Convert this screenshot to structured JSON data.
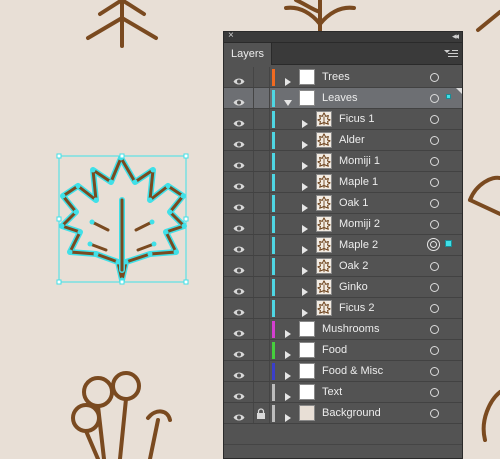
{
  "panel": {
    "tab_label": "Layers",
    "close_glyph": "×",
    "collapse_glyph": "◂◂"
  },
  "layers": [
    {
      "label": "Trees",
      "level": 0,
      "expanded": false,
      "color": "#f06a21",
      "thumb": "white",
      "selected": false,
      "active_target": false,
      "sel_square": false,
      "lock": false
    },
    {
      "label": "Leaves",
      "level": 0,
      "expanded": true,
      "color": "#4fd6e3",
      "thumb": "white",
      "selected": true,
      "active_target": false,
      "sel_square": true,
      "lock": false
    },
    {
      "label": "Ficus 1",
      "level": 1,
      "expanded": false,
      "color": "#4fd6e3",
      "thumb": "leaf",
      "selected": false,
      "active_target": false,
      "sel_square": false,
      "lock": false
    },
    {
      "label": "Alder",
      "level": 1,
      "expanded": false,
      "color": "#4fd6e3",
      "thumb": "leaf",
      "selected": false,
      "active_target": false,
      "sel_square": false,
      "lock": false
    },
    {
      "label": "Momiji 1",
      "level": 1,
      "expanded": false,
      "color": "#4fd6e3",
      "thumb": "leaf",
      "selected": false,
      "active_target": false,
      "sel_square": false,
      "lock": false
    },
    {
      "label": "Maple 1",
      "level": 1,
      "expanded": false,
      "color": "#4fd6e3",
      "thumb": "leaf",
      "selected": false,
      "active_target": false,
      "sel_square": false,
      "lock": false
    },
    {
      "label": "Oak 1",
      "level": 1,
      "expanded": false,
      "color": "#4fd6e3",
      "thumb": "leaf",
      "selected": false,
      "active_target": false,
      "sel_square": false,
      "lock": false
    },
    {
      "label": "Momiji 2",
      "level": 1,
      "expanded": false,
      "color": "#4fd6e3",
      "thumb": "leaf",
      "selected": false,
      "active_target": false,
      "sel_square": false,
      "lock": false
    },
    {
      "label": "Maple 2",
      "level": 1,
      "expanded": false,
      "color": "#4fd6e3",
      "thumb": "leaf",
      "selected": false,
      "active_target": true,
      "sel_square": true,
      "lock": false
    },
    {
      "label": "Oak 2",
      "level": 1,
      "expanded": false,
      "color": "#4fd6e3",
      "thumb": "leaf",
      "selected": false,
      "active_target": false,
      "sel_square": false,
      "lock": false
    },
    {
      "label": "Ginko",
      "level": 1,
      "expanded": false,
      "color": "#4fd6e3",
      "thumb": "leaf",
      "selected": false,
      "active_target": false,
      "sel_square": false,
      "lock": false
    },
    {
      "label": "Ficus 2",
      "level": 1,
      "expanded": false,
      "color": "#4fd6e3",
      "thumb": "leaf",
      "selected": false,
      "active_target": false,
      "sel_square": false,
      "lock": false
    },
    {
      "label": "Mushrooms",
      "level": 0,
      "expanded": false,
      "color": "#d43fd0",
      "thumb": "white",
      "selected": false,
      "active_target": false,
      "sel_square": false,
      "lock": false
    },
    {
      "label": "Food",
      "level": 0,
      "expanded": false,
      "color": "#46cf3d",
      "thumb": "white",
      "selected": false,
      "active_target": false,
      "sel_square": false,
      "lock": false
    },
    {
      "label": "Food & Misc",
      "level": 0,
      "expanded": false,
      "color": "#3b3fc9",
      "thumb": "white",
      "selected": false,
      "active_target": false,
      "sel_square": false,
      "lock": false
    },
    {
      "label": "Text",
      "level": 0,
      "expanded": false,
      "color": "#bdbdbd",
      "thumb": "white",
      "selected": false,
      "active_target": false,
      "sel_square": false,
      "lock": false
    },
    {
      "label": "Background",
      "level": 0,
      "expanded": false,
      "color": "#bdbdbd",
      "thumb": "beige",
      "selected": false,
      "active_target": false,
      "sel_square": false,
      "lock": true
    }
  ],
  "colors": {
    "canvas_bg": "#e8dfd6",
    "artwork_stroke": "#7a4a20",
    "selection": "#40e0e8"
  },
  "icons": {
    "visibility": "eye-icon",
    "lock": "lock-icon",
    "expand": "triangle-right-icon",
    "collapse": "triangle-down-icon",
    "target": "target-circle-icon",
    "panel_menu": "hamburger-menu-icon"
  }
}
